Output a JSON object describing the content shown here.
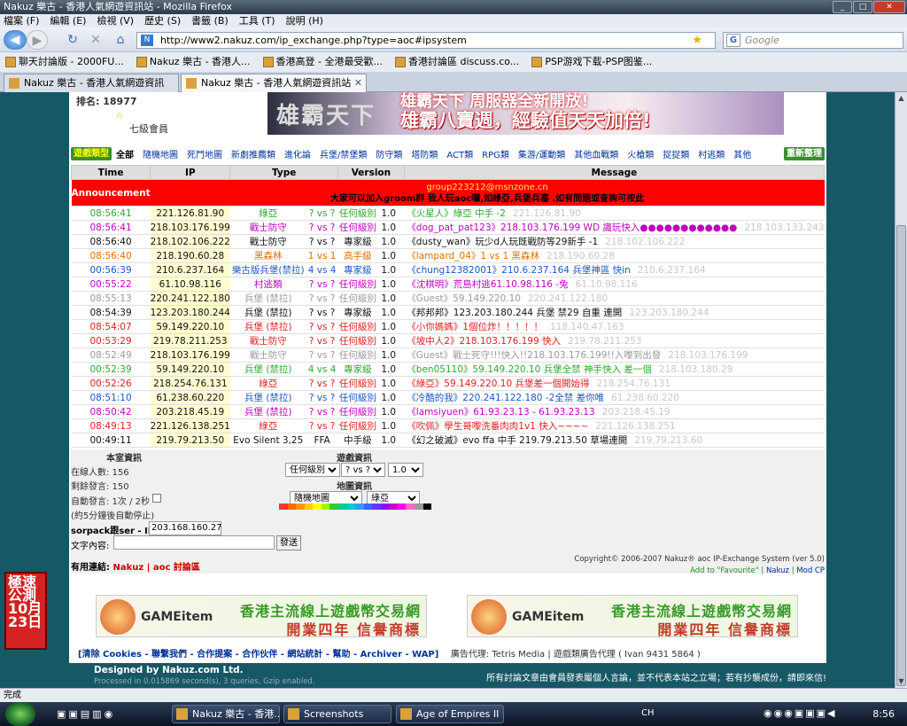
{
  "window": {
    "title": "Nakuz 樂古 - 香港人氣網遊資訊站 - Mozilla Firefox"
  },
  "menu": [
    "檔案 (F)",
    "編輯 (E)",
    "檢視 (V)",
    "歷史 (S)",
    "書籤 (B)",
    "工具 (T)",
    "說明 (H)"
  ],
  "nav": {
    "url": "http://www2.nakuz.com/ip_exchange.php?type=aoc#ipsystem",
    "search_placeholder": "Google"
  },
  "bookmarks": [
    "聊天討論版 - 2000FU...",
    "Nakuz 樂古 - 香港人...",
    "香港高登 - 全港最受歡...",
    "香港討論區 discuss.co...",
    "PSP游戏下载-PSP图鉴..."
  ],
  "tabs": [
    "Nakuz 樂古 - 香港人氣網遊資訊站",
    "Nakuz 樂古 - 香港人氣網遊資訊站"
  ],
  "user": {
    "rank_label": "排名: 18977",
    "level": "七級會員"
  },
  "banner": {
    "line1": "雄霸天下  周服器全新開放!",
    "line2": "雄霸八寶週，經驗值天天加倍!",
    "logo": "雄霸天下"
  },
  "categories": {
    "type_btn": "遊戲類型",
    "items": [
      "全部",
      "隨機地圖",
      "死鬥地圖",
      "新劇推薦類",
      "進化論",
      "兵堡/禁堡類",
      "防守類",
      "塔防類",
      "ACT類",
      "RPG類",
      "集游/運動類",
      "其他血戰類",
      "火槍類",
      "捉捉類",
      "村逃類",
      "其他"
    ],
    "refresh": "重新整理"
  },
  "table": {
    "headers": [
      "Time",
      "IP",
      "Type",
      "Version",
      "Message"
    ],
    "announcement": {
      "label": "Announcement",
      "msg1": "group223212@msnzone.cn",
      "msg2": "大家可以加入groom群 我人玩aoc囉,如綠亞,兵堡兵塞 .如有問題或查詢可按此"
    },
    "rows": [
      {
        "time": "08:56:41",
        "ip": "221.126.81.90",
        "type": "綠亞",
        "vs": "? vs ?",
        "level": "任何級別",
        "ver": "1.0",
        "msg": "《火星人》綠亞 中手 -2",
        "ipr": "221.126.81.90",
        "c": "grn"
      },
      {
        "time": "08:56:41",
        "ip": "218.103.176.199",
        "type": "戰士防守",
        "vs": "? vs ?",
        "level": "任何級別",
        "ver": "1.0",
        "msg": "《dog_pat_pat123》218.103.176.199 WD 識玩快入●●●●●●●●●●●●",
        "ipr": "218.103.133.243",
        "c": "pur"
      },
      {
        "time": "08:56:40",
        "ip": "218.102.106.222",
        "type": "戰士防守",
        "vs": "? vs ?",
        "level": "專家級",
        "ver": "1.0",
        "msg": "《dusty_wan》玩少d人玩既戰防等29新手 -1",
        "ipr": "218.102.106.222",
        "c": "drk"
      },
      {
        "time": "08:56:40",
        "ip": "218.190.60.28",
        "type": "黑森林",
        "vs": "1 vs 1",
        "level": "高手級",
        "ver": "1.0",
        "msg": "《lampard_04》1 vs 1 黑森林",
        "ipr": "218.190.60.28",
        "c": "org"
      },
      {
        "time": "00:56:39",
        "ip": "210.6.237.164",
        "type": "樂古版兵堡(禁拉)",
        "vs": "4 vs 4",
        "level": "專家級",
        "ver": "1.0",
        "msg": "《chung12382001》210.6.237.164 兵堡神區 快in",
        "ipr": "210.6.237.164",
        "c": "blu"
      },
      {
        "time": "00:55:22",
        "ip": "61.10.98.116",
        "type": "村逃類",
        "vs": "? vs ?",
        "level": "任何級別",
        "ver": "1.0",
        "msg": "《沈棋明》荒島村逃61.10.98.116 -兔",
        "ipr": "61.10.98.116",
        "c": "pur"
      },
      {
        "time": "08:55:13",
        "ip": "220.241.122.180",
        "type": "兵堡 (禁拉)",
        "vs": "? vs ?",
        "level": "任何級別",
        "ver": "1.0",
        "msg": "《Guest》59.149.220.10",
        "ipr": "220.241.122.180",
        "c": "gry"
      },
      {
        "time": "08:54:39",
        "ip": "123.203.180.244",
        "type": "兵堡 (禁拉)",
        "vs": "? vs ?",
        "level": "專家級",
        "ver": "1.0",
        "msg": "《邦邦邦》123.203.180.244 兵堡 禁29 自重 連開",
        "ipr": "123.203.180.244",
        "c": "drk"
      },
      {
        "time": "08:54:07",
        "ip": "59.149.220.10",
        "type": "兵堡 (禁拉)",
        "vs": "? vs ?",
        "level": "任何級別",
        "ver": "1.0",
        "msg": "《小你媽媽》1個位炸！！！！！",
        "ipr": "118.140.47.163",
        "c": "red"
      },
      {
        "time": "00:53:29",
        "ip": "219.78.211.253",
        "type": "戰士防守",
        "vs": "? vs ?",
        "level": "任何級別",
        "ver": "1.0",
        "msg": "《坡中人2》218.103.176.199 快入",
        "ipr": "219.78.211.253",
        "c": "red"
      },
      {
        "time": "08:52:49",
        "ip": "218.103.176.199",
        "type": "戰士防守",
        "vs": "? vs ?",
        "level": "任何級別",
        "ver": "1.0",
        "msg": "《Guest》戰士死守!!!快入!!218.103.176.199!!入嚟到出發",
        "ipr": "218.103.176.199",
        "c": "gry"
      },
      {
        "time": "00:52:39",
        "ip": "59.149.220.10",
        "type": "兵堡 (禁拉)",
        "vs": "4 vs 4",
        "level": "專家級",
        "ver": "1.0",
        "msg": "《ben05110》59.149.220.10 兵堡全禁 神手快入 差一個",
        "ipr": "218.103.180.29",
        "c": "grn"
      },
      {
        "time": "00:52:26",
        "ip": "218.254.76.131",
        "type": "綠亞",
        "vs": "? vs ?",
        "level": "任何級別",
        "ver": "1.0",
        "msg": "《綠亞》59.149.220.10 兵堡差一個開始得",
        "ipr": "218.254.76.131",
        "c": "red"
      },
      {
        "time": "08:51:10",
        "ip": "61.238.60.220",
        "type": "兵堡 (禁拉)",
        "vs": "? vs ?",
        "level": "任何級別",
        "ver": "1.0",
        "msg": "《冷酷的我》220.241.122.180 -2全禁 差你唯",
        "ipr": "61.238.60.220",
        "c": "blu"
      },
      {
        "time": "08:50:42",
        "ip": "203.218.45.19",
        "type": "兵堡 (禁拉)",
        "vs": "? vs ?",
        "level": "任何級別",
        "ver": "1.0",
        "msg": "《lamsiyuen》61.93.23.13 - 61.93.23.13",
        "ipr": "203.218.45.19",
        "c": "pur"
      },
      {
        "time": "08:49:13",
        "ip": "221.126.138.251",
        "type": "綠亞",
        "vs": "? vs ?",
        "level": "任何級別",
        "ver": "1.0",
        "msg": "《吹佩》學生哥嚟洗番肉肉1v1 快入~~~~",
        "ipr": "221.126.138.251",
        "c": "red"
      },
      {
        "time": "00:49:11",
        "ip": "219.79.213.50",
        "type": "Evo Silent 3,25",
        "vs": "FFA",
        "level": "中手級",
        "ver": "1.0",
        "msg": "《幻之破滅》evo ffa 中手 219.79.213.50 草場連開",
        "ipr": "219.79.213.60",
        "c": "drk"
      }
    ]
  },
  "room": {
    "title": "本室資訊",
    "online": "在線人數: 156",
    "remaining": "剩餘發言: 150",
    "auto": "自動發言: 1次 / 2秒",
    "auto_note": "(約5分鐘後自動停止)",
    "game_title": "遊戲資訊",
    "map_title": "地圖資訊",
    "level_sel": "任何級別",
    "vs_sel": "? vs ?",
    "ver_sel": "1.0",
    "map_sel": "隨機地圖",
    "type_sel": "綠亞",
    "ip_label": "sorpack跟ser - IP:",
    "ip_value": "203.168.160.27",
    "msg_label": "文字內容:",
    "send": "發送",
    "links_label": "有用連結:",
    "link1": "Nakuz",
    "link2": "aoc 討論區",
    "copyright": "Copyright© 2006-2007  Nakuz® aoc IP-Exchange System (ver 5.0)",
    "add_fav": "Add to \"Favourite\"",
    "nakuz": "Nakuz",
    "modcp": "Mod CP"
  },
  "ads": {
    "t1": "香港主流線上遊戲幣交易網",
    "t2": "開業四年  信譽商標",
    "logo": "GAMEitem"
  },
  "footer": {
    "links": "[清除 Cookies - 聯繫我們 - 合作提案 - 合作伙伴 - 網站統計 - 幫助 - Archiver - WAP]",
    "agent": "廣告代理: Tetris Media | 遊戲類廣告代理 ( Ivan 9431 5864 )",
    "designed": "Designed by Nakuz.com Ltd.",
    "processed": "Processed in 0.015869 second(s), 3 queries, Gzip enabled.",
    "disclaimer": "所有討論文章由會員發表屬個人言論，並不代表本站之立場；若有抄襲成份，請即來信!"
  },
  "vbanner": "極速公測 10月23日",
  "status": "完成",
  "taskbar": {
    "items": [
      "Nakuz 樂古 - 香港...",
      "Screenshots",
      "Age of Empires II E..."
    ],
    "lang": "CH",
    "clock": "8:56"
  },
  "palette": [
    "#ff3333",
    "#ff6600",
    "#ff9900",
    "#ffcc00",
    "#ffff00",
    "#99ff00",
    "#33cc33",
    "#00cc99",
    "#00cccc",
    "#3399ff",
    "#3366ff",
    "#6633ff",
    "#9900ff",
    "#cc00cc",
    "#ff00ff",
    "#ff66cc",
    "#999999",
    "#000000"
  ]
}
